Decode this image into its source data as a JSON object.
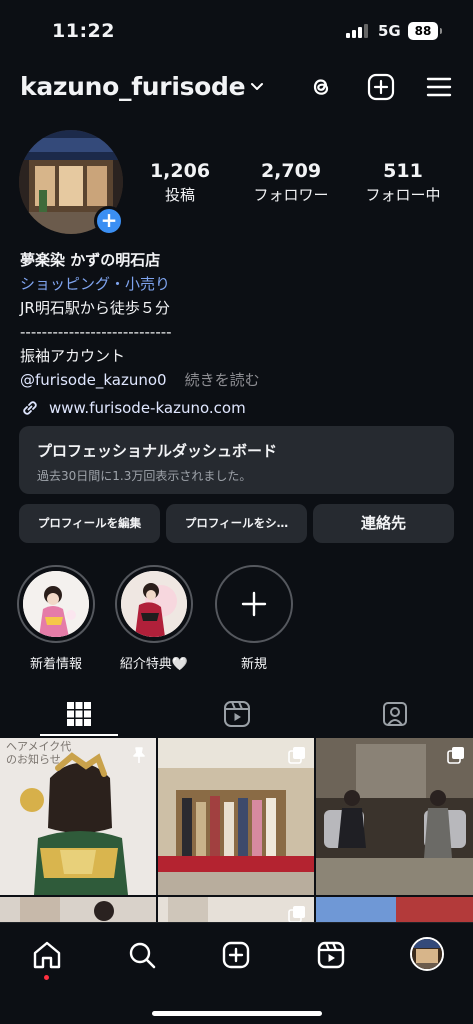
{
  "status": {
    "time": "11:22",
    "network": "5G",
    "battery": "88"
  },
  "header": {
    "username": "kazuno_furisode"
  },
  "stats": [
    {
      "value": "1,206",
      "label": "投稿"
    },
    {
      "value": "2,709",
      "label": "フォロワー"
    },
    {
      "value": "511",
      "label": "フォロー中"
    }
  ],
  "bio": {
    "name": "夢楽染 かずの明石店",
    "category": "ショッピング・小売り",
    "line1": "JR明石駅から徒歩５分",
    "divider": "----------------------------",
    "line2": "振袖アカウント",
    "mention": "@furisode_kazuno0",
    "more": "続きを読む",
    "link": "www.furisode-kazuno.com"
  },
  "dashboard": {
    "title": "プロフェッショナルダッシュボード",
    "subtitle": "過去30日間に1.3万回表示されました。"
  },
  "buttons": {
    "edit": "プロフィールを編集",
    "share": "プロフィールをシ…",
    "contact": "連絡先"
  },
  "highlights": [
    {
      "label": "新着情報"
    },
    {
      "label": "紹介特典🤍"
    },
    {
      "label": "新規"
    }
  ],
  "posts": [
    {
      "overlay_text": "ヘアメイク代\nのお知らせ",
      "pinned": true
    },
    {
      "overlay_text": "",
      "pinned": false
    },
    {
      "overlay_text": "",
      "pinned": false
    }
  ],
  "colors": {
    "accent": "#3b8ff3",
    "background": "#0c0f14",
    "card": "#262a30",
    "notification": "#ff3040"
  }
}
